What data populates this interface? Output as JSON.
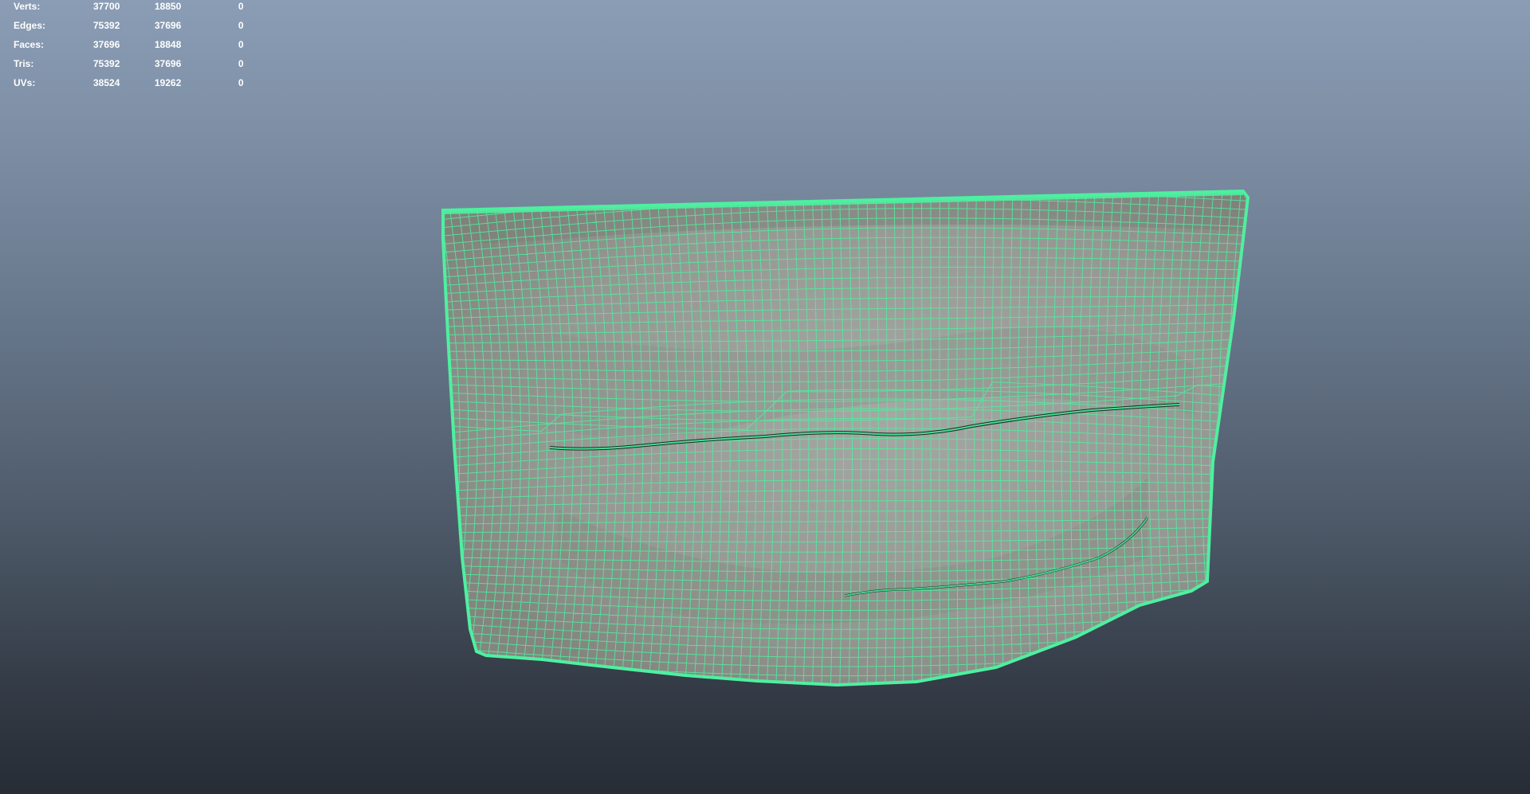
{
  "hud": {
    "rows": [
      {
        "label": "Verts:",
        "a": "37700",
        "b": "18850",
        "c": "0"
      },
      {
        "label": "Edges:",
        "a": "75392",
        "b": "37696",
        "c": "0"
      },
      {
        "label": "Faces:",
        "a": "37696",
        "b": "18848",
        "c": "0"
      },
      {
        "label": "Tris:",
        "a": "75392",
        "b": "37696",
        "c": "0"
      },
      {
        "label": "UVs:",
        "a": "38524",
        "b": "19262",
        "c": "0"
      }
    ]
  },
  "colors": {
    "wireframe": "#4ef0a0",
    "surface": "#9a9b98",
    "mouth_line": "#1e2a25",
    "background_top": "#8a9db5",
    "background_bottom": "#272c35",
    "hud_text": "#ffffff"
  }
}
